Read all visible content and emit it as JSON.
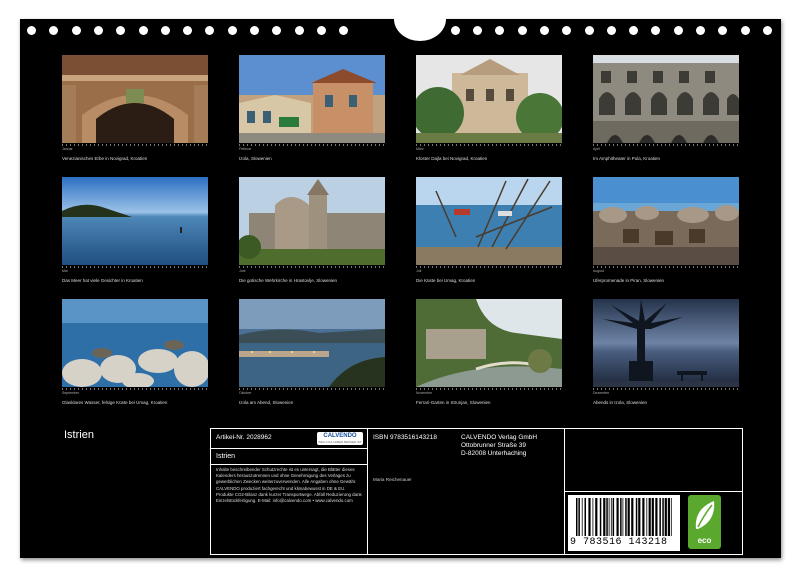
{
  "calendar": {
    "title": "Istrien",
    "months": [
      {
        "month": "Januar",
        "caption": "Venezianisches Erbe in Novigrad, Kroatien"
      },
      {
        "month": "Februar",
        "caption": "Izola, Slowenien"
      },
      {
        "month": "März",
        "caption": "Kloster Dajla bei Novigrad, Kroatien"
      },
      {
        "month": "April",
        "caption": "Im Amphitheater in Pula, Kroatien"
      },
      {
        "month": "Mai",
        "caption": "Das Meer hat viele Gesichter in Kroatien"
      },
      {
        "month": "Juni",
        "caption": "Die gotische Wehrkirche in Hrastovlje, Slowenien"
      },
      {
        "month": "Juli",
        "caption": "Die Küste bei Umag, Kroatien"
      },
      {
        "month": "August",
        "caption": "Uferpromenade in Piran, Slowenien"
      },
      {
        "month": "September",
        "caption": "Glasklares Wasser, felsige Küste bei Umag, Kroatien"
      },
      {
        "month": "Oktober",
        "caption": "Izola am Abend, Slowenien"
      },
      {
        "month": "November",
        "caption": "Ferrari-Garten in Strunjan, Slowenien"
      },
      {
        "month": "Dezember",
        "caption": "Abends in Izola, Slowenien"
      }
    ]
  },
  "info": {
    "article_no": "Artikel-Nr. 2028962",
    "logo": "CALVENDO",
    "logo_sub": "WEIL DAS LEBEN BESSER IST",
    "title": "Istrien",
    "legal": "Inhalte beschreibender Schutzrechte ist es untersagt, die Blätter dieses Kalenders herauszutrennen und ohne Genehmigung des Verlages zu gewerblichen Zwecken weiterzuverwenden. Alle Angaben ohne Gewähr. CALVENDO produziert fachgerecht und klimabewusst in DE & EU. Produkte CO2-Bilanz dank kurzer Transportwege. Abfall Reduzierung dank Einzelstückfertigung. E-Mail: info@calvendo.com • www.calvendo.com",
    "isbn": "ISBN 9783516143218",
    "author": "Maria Reichenauer",
    "publisher_name": "CALVENDO Verlag GmbH",
    "publisher_street": "Ottobrunner Straße 39",
    "publisher_city": "D-82008 Unterhaching",
    "barcode_number": "9 783516 143218",
    "eco_label": "eco"
  },
  "colors": {
    "background": "#000000",
    "accent_green": "#5aa92e"
  }
}
